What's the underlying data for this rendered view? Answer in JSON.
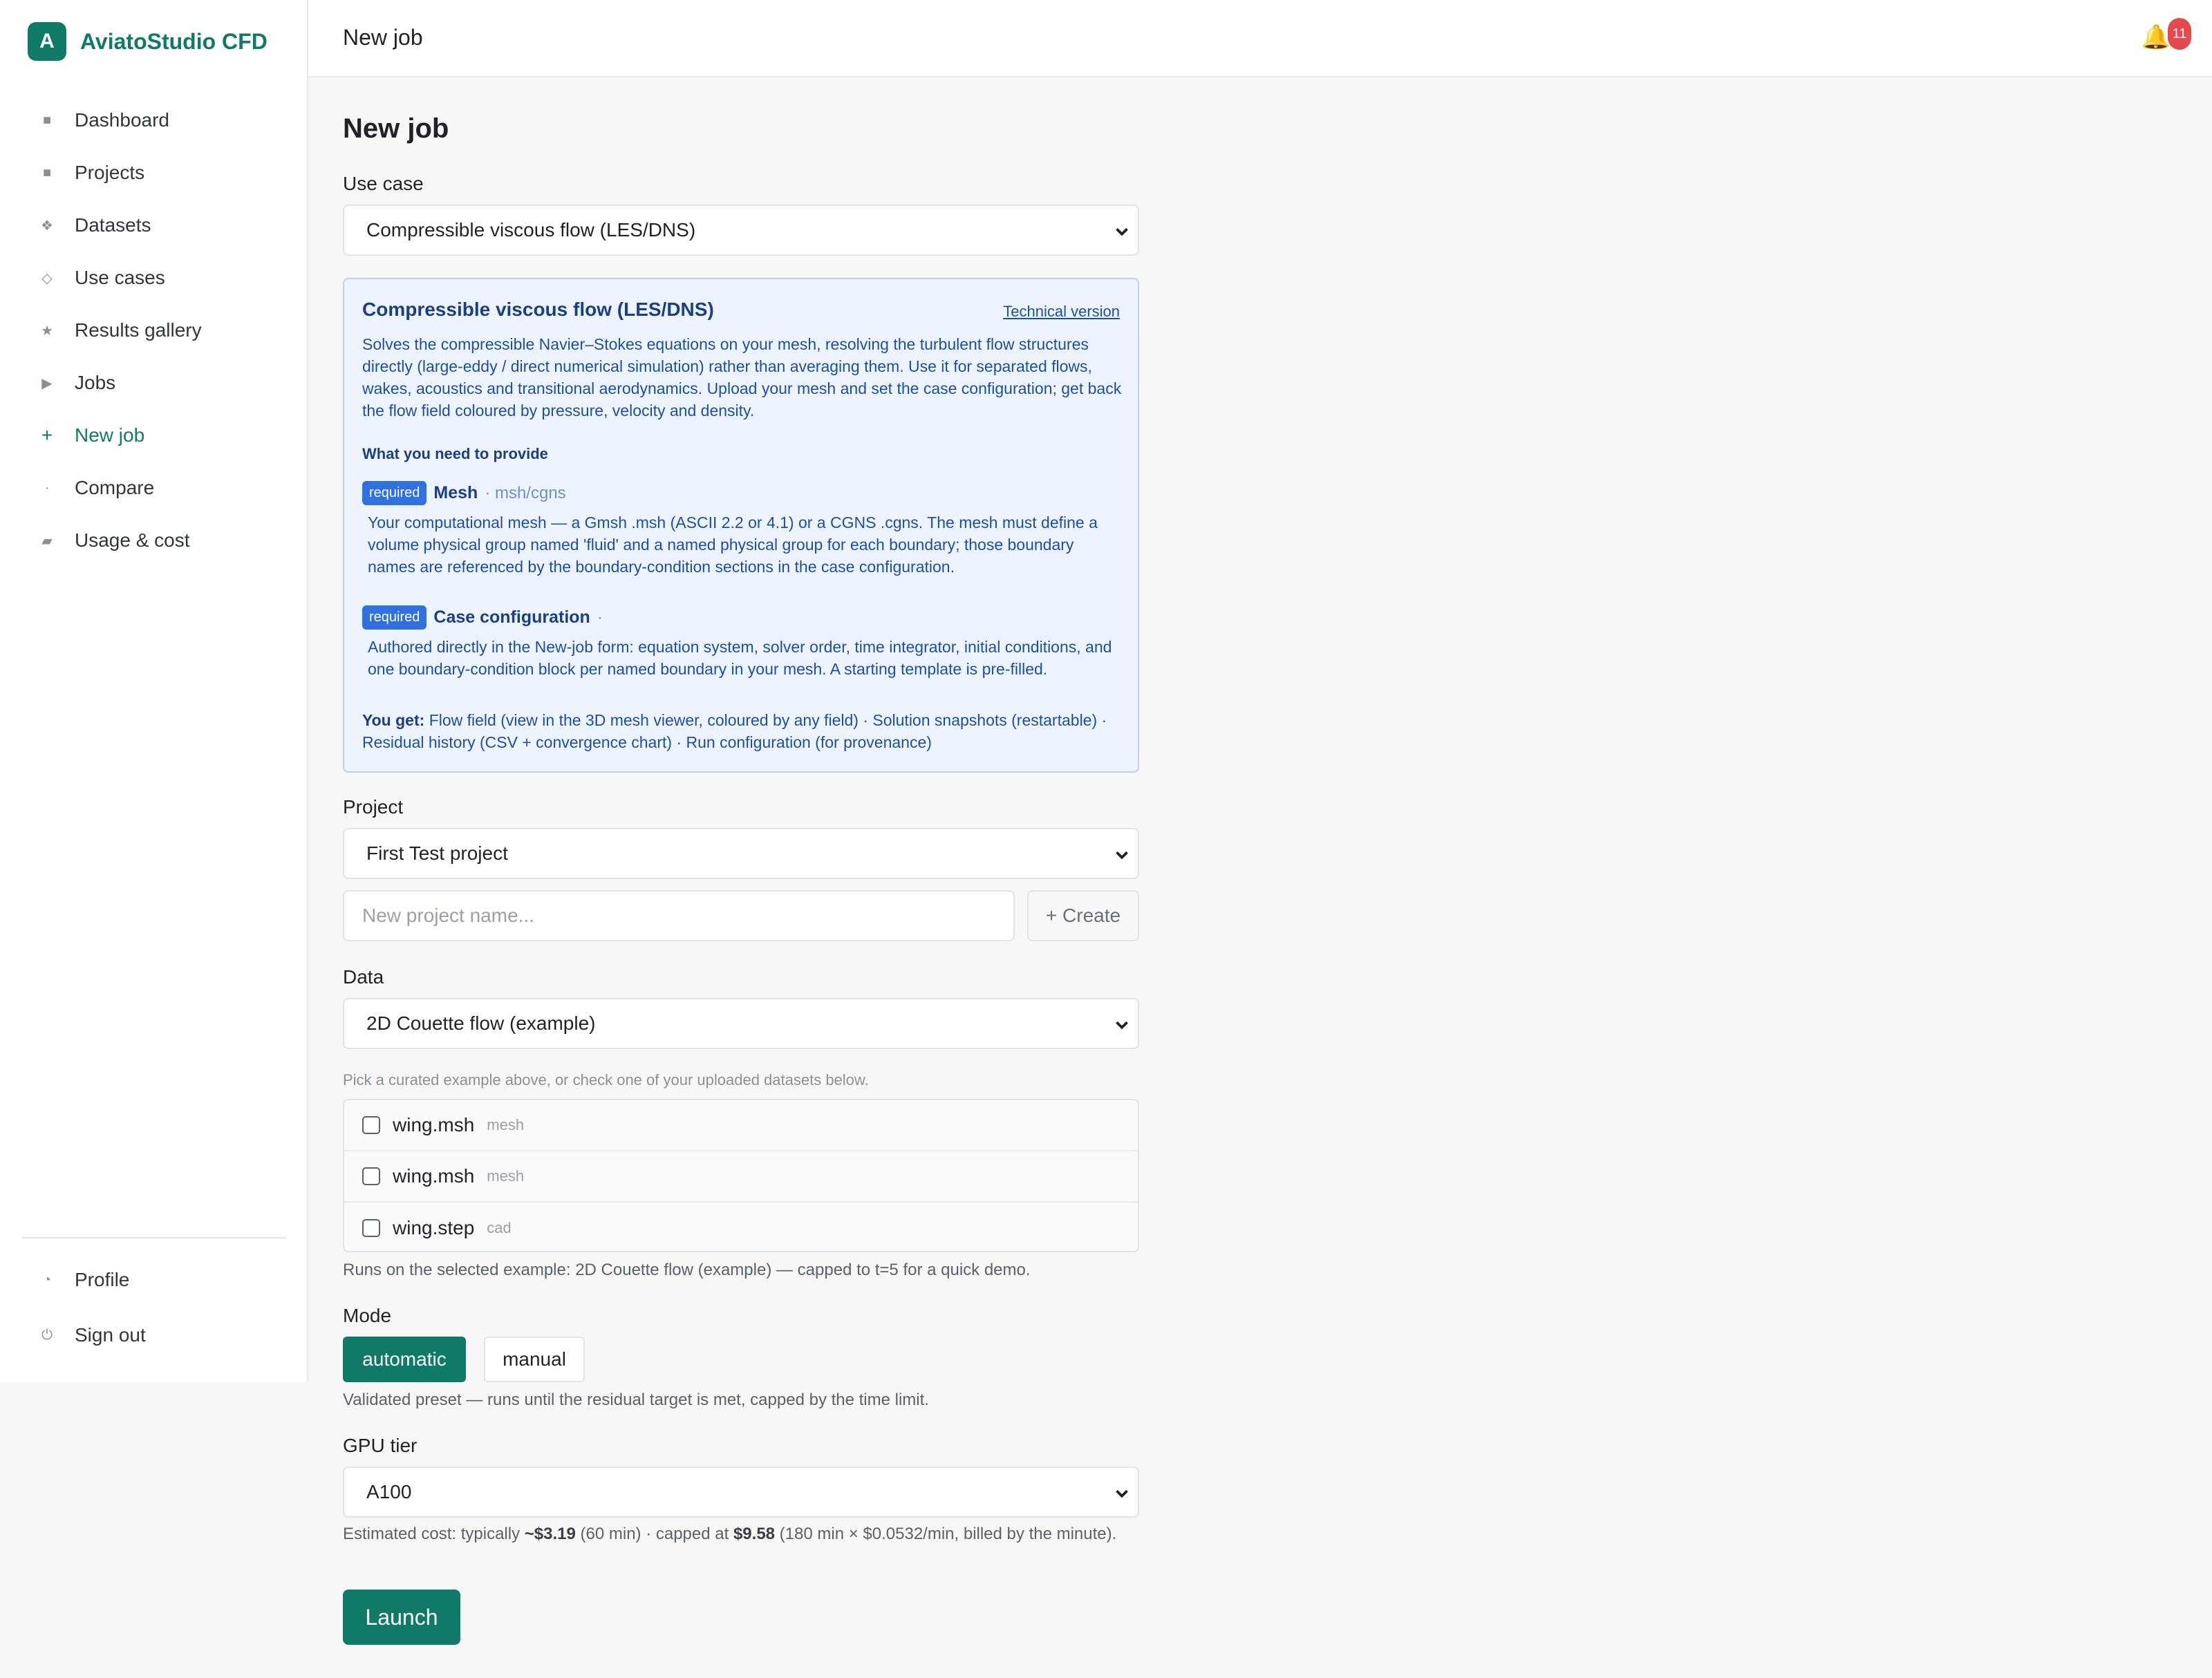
{
  "app": {
    "logo_letter": "A",
    "name": "AviatoStudio CFD"
  },
  "sidebar": {
    "items": [
      {
        "label": "Dashboard",
        "icon": "■"
      },
      {
        "label": "Projects",
        "icon": "■"
      },
      {
        "label": "Datasets",
        "icon": "❖"
      },
      {
        "label": "Use cases",
        "icon": "◇"
      },
      {
        "label": "Results gallery",
        "icon": "★"
      },
      {
        "label": "Jobs",
        "icon": "▶"
      },
      {
        "label": "New job",
        "icon": "+"
      },
      {
        "label": "Compare",
        "icon": "·"
      },
      {
        "label": "Usage & cost",
        "icon": "▰"
      }
    ],
    "bottom": [
      {
        "label": "Profile",
        "icon": "◔"
      },
      {
        "label": "Sign out",
        "icon": "⏻"
      }
    ]
  },
  "header": {
    "title": "New job",
    "notification_count": "11"
  },
  "main": {
    "title": "New job",
    "use_case": {
      "label": "Use case",
      "selected": "Compressible viscous flow (LES/DNS)"
    },
    "info": {
      "title": "Compressible viscous flow (LES/DNS)",
      "technical_link": "Technical version",
      "description": "Solves the compressible Navier–Stokes equations on your mesh, resolving the turbulent flow structures directly (large-eddy / direct numerical simulation) rather than averaging them. Use it for separated flows, wakes, acoustics and transitional aerodynamics. Upload your mesh and set the case configuration; get back the flow field coloured by pressure, velocity and density.",
      "need_heading": "What you need to provide",
      "requirements": [
        {
          "badge": "required",
          "name": "Mesh",
          "format": "· msh/cgns",
          "description": "Your computational mesh — a Gmsh .msh (ASCII 2.2 or 4.1) or a CGNS .cgns. The mesh must define a volume physical group named 'fluid' and a named physical group for each boundary; those boundary names are referenced by the boundary-condition sections in the case configuration."
        },
        {
          "badge": "required",
          "name": "Case configuration",
          "format": "·",
          "description": "Authored directly in the New-job form: equation system, solver order, time integrator, initial conditions, and one boundary-condition block per named boundary in your mesh. A starting template is pre-filled."
        }
      ],
      "you_get_label": "You get:",
      "you_get": "Flow field (view in the 3D mesh viewer, coloured by any field) · Solution snapshots (restartable) · Residual history (CSV + convergence chart) · Run configuration (for provenance)"
    },
    "project": {
      "label": "Project",
      "selected": "First Test project",
      "new_placeholder": "New project name...",
      "create_label": "+ Create"
    },
    "data": {
      "label": "Data",
      "selected": "2D Couette flow (example)",
      "hint": "Pick a curated example above, or check one of your uploaded datasets below.",
      "datasets": [
        {
          "name": "wing.msh",
          "type": "mesh"
        },
        {
          "name": "wing.msh",
          "type": "mesh"
        },
        {
          "name": "wing.step",
          "type": "cad"
        }
      ],
      "note": "Runs on the selected example: 2D Couette flow (example) — capped to t=5 for a quick demo."
    },
    "mode": {
      "label": "Mode",
      "automatic": "automatic",
      "manual": "manual",
      "note": "Validated preset — runs until the residual target is met, capped by the time limit."
    },
    "gpu": {
      "label": "GPU tier",
      "selected": "A100",
      "cost_prefix": "Estimated cost: typically ",
      "typical": "~$3.19",
      "cost_mid": " (60 min) · capped at ",
      "cap": "$9.58",
      "cost_suffix": " (180 min × $0.0532/min, billed by the minute)."
    },
    "launch_label": "Launch"
  },
  "colors": {
    "accent": "#0f7a66",
    "info_bg": "#edf4fd",
    "badge": "#2f6fe0",
    "notification": "#e5484d"
  }
}
